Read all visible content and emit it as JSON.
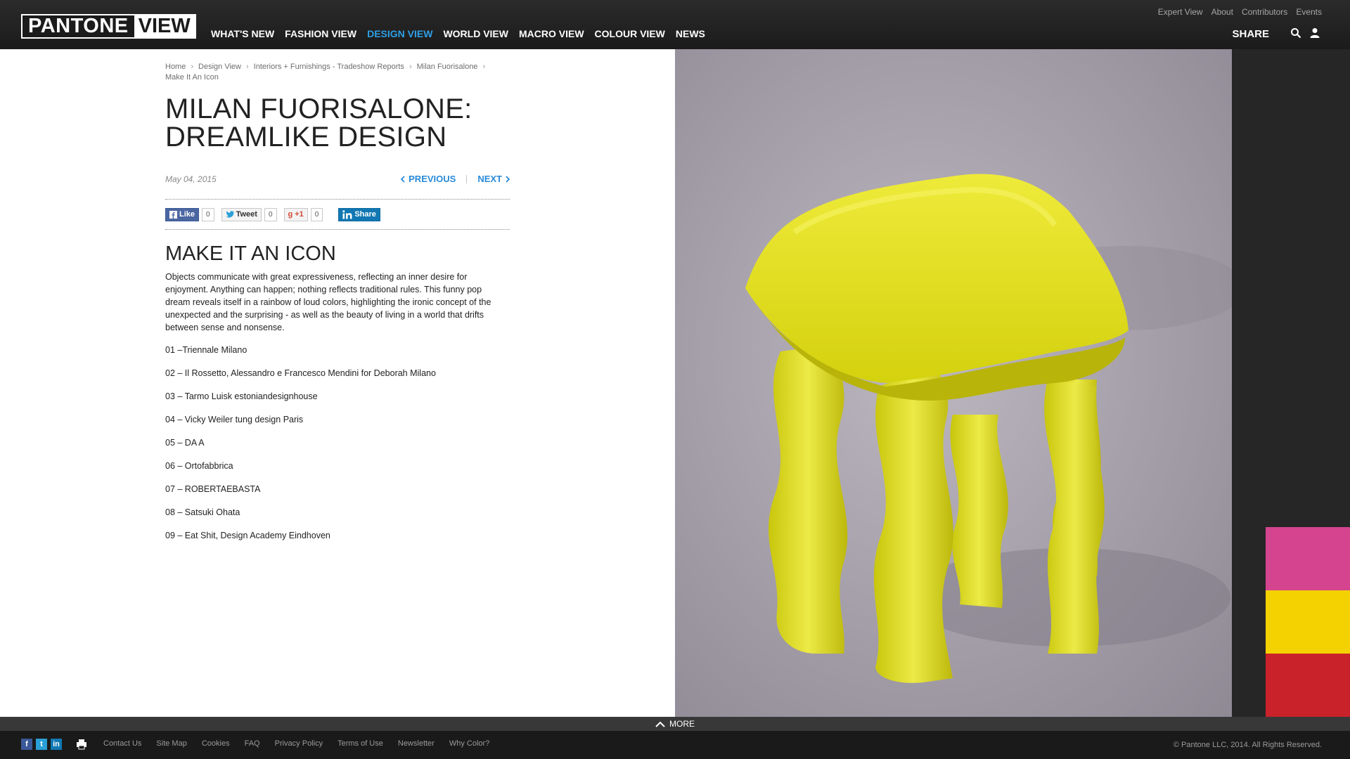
{
  "logo": {
    "part1": "PANTONE",
    "part2": "VIEW"
  },
  "nav": {
    "items": [
      "WHAT'S NEW",
      "FASHION VIEW",
      "DESIGN VIEW",
      "WORLD VIEW",
      "MACRO VIEW",
      "COLOUR VIEW",
      "NEWS"
    ],
    "active": "DESIGN VIEW"
  },
  "utility": {
    "items": [
      "Expert View",
      "About",
      "Contributors",
      "Events"
    ]
  },
  "header": {
    "share_label": "SHARE",
    "search_icon": "search-icon",
    "user_icon": "user-icon"
  },
  "breadcrumb": {
    "items": [
      "Home",
      "Design View",
      "Interiors + Furnishings - Tradeshow Reports",
      "Milan Fuorisalone",
      "Make It An Icon"
    ]
  },
  "article": {
    "title_line1": "MILAN FUORISALONE:",
    "title_line2": "DREAMLIKE DESIGN",
    "date": "May 04, 2015",
    "previous_label": "PREVIOUS",
    "next_label": "NEXT",
    "section_title": "MAKE IT AN ICON",
    "intro": "Objects communicate with great expressiveness, reflecting an inner desire for enjoyment. Anything can happen; nothing reflects traditional rules. This funny pop dream reveals itself in a rainbow of loud colors, highlighting the ironic concept of the unexpected and the surprising - as well as the beauty of living in a world that drifts between sense and nonsense.",
    "list": [
      "01 –Triennale Milano",
      "02 – Il Rossetto, Alessandro e Francesco Mendini for Deborah Milano",
      "03 – Tarmo Luisk estoniandesignhouse",
      "04 – Vicky Weiler tung design Paris",
      "05 – DA A",
      "06 – Ortofabbrica",
      "07 – ROBERTAEBASTA",
      "08 – Satsuki Ohata",
      "09 – Eat Shit, Design Academy Eindhoven"
    ]
  },
  "social": {
    "like_label": "Like",
    "like_count": "0",
    "tweet_label": "Tweet",
    "tweet_count": "0",
    "gplus_label": "+1",
    "gplus_count": "0",
    "share_label": "Share"
  },
  "swatches": {
    "colors": [
      "#d5448f",
      "#f4d100",
      "#c9222a"
    ]
  },
  "footer": {
    "more_label": "MORE",
    "links": [
      "Contact Us",
      "Site Map",
      "Cookies",
      "FAQ",
      "Privacy Policy",
      "Terms of Use",
      "Newsletter",
      "Why Color?"
    ],
    "copyright": "© Pantone LLC, 2014. All Rights Reserved."
  },
  "colors": {
    "accent": "#2e9fe6",
    "link": "#2a8ad8",
    "header_bg": "#1b1b1b",
    "object_yellow": "#e4e21c"
  }
}
